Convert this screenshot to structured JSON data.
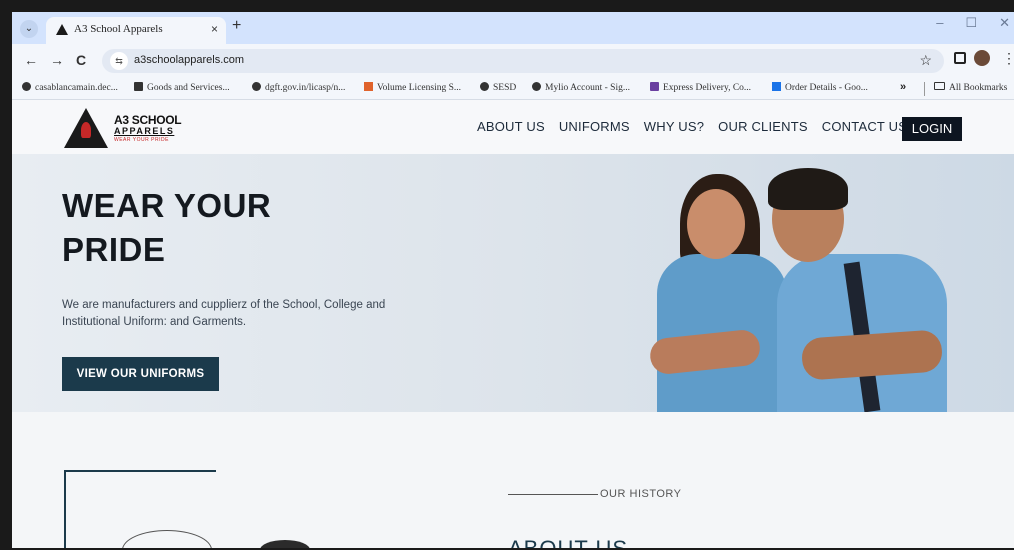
{
  "browser": {
    "tab_title": "A3 School Apparels",
    "tab_close": "×",
    "new_tab": "+",
    "url": "a3schoolapparels.com",
    "nav_back": "←",
    "nav_forward": "→",
    "nav_reload": "C",
    "star": "☆",
    "kebab": "⋮",
    "window_controls": [
      "–",
      "☐",
      "✕"
    ],
    "bookmarks": [
      "casablancamain.dec...",
      "Goods and Services...",
      "dgft.gov.in/licasp/n...",
      "Volume Licensing S...",
      "SESD",
      "Mylio Account - Sig...",
      "Express Delivery, Co...",
      "Order Details - Goo..."
    ],
    "bookmarks_more": "»",
    "all_bookmarks": "All Bookmarks"
  },
  "site": {
    "logo_name": "A3 SCHOOL",
    "logo_sub": "APPARELS",
    "logo_tag": "WEAR YOUR PRIDE",
    "nav": [
      "ABOUT US",
      "UNIFORMS",
      "WHY US?",
      "OUR CLIENTS",
      "CONTACT US"
    ],
    "login": "LOGIN"
  },
  "hero": {
    "title": "WEAR YOUR PRIDE",
    "text": "We are manufacturers and cupplierz of the School, College and Institutional Uniform: and Garments.",
    "cta": "VIEW OUR UNIFORMS"
  },
  "about": {
    "label": "OUR HISTORY",
    "title": "ABOUT US"
  }
}
